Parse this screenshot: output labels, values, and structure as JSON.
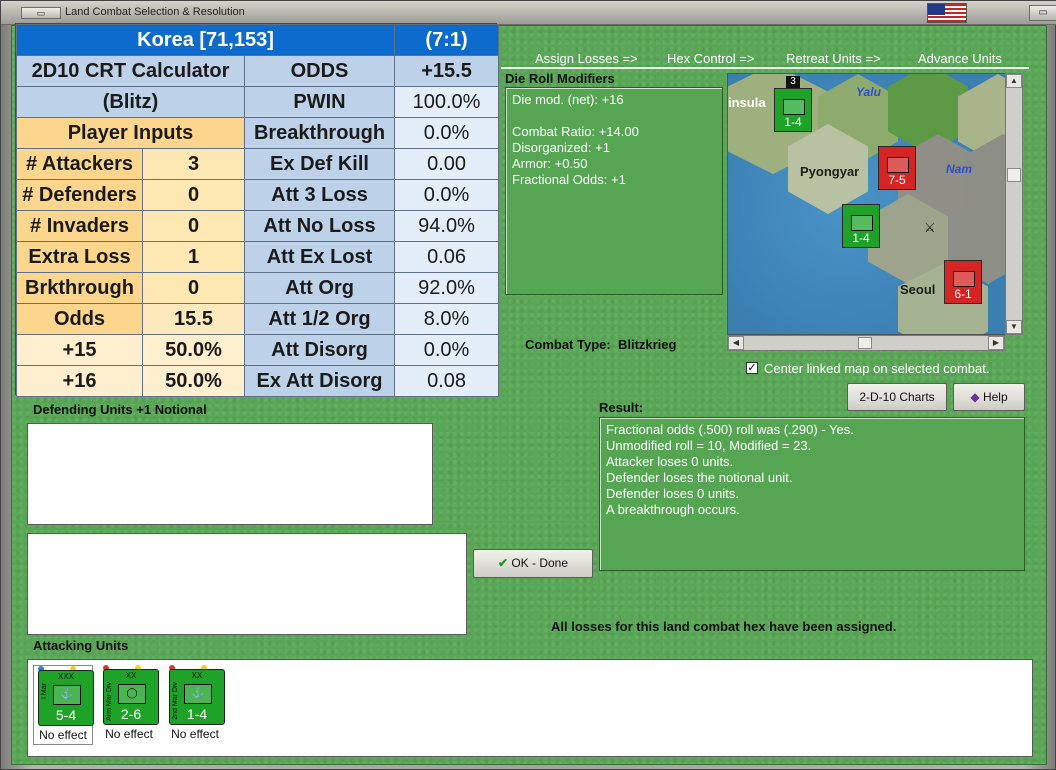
{
  "window": {
    "title": "Land Combat Selection & Resolution"
  },
  "steps": [
    "Assign Losses =>",
    "Hex Control =>",
    "Retreat Units =>",
    "Advance Units"
  ],
  "calculator": {
    "title": "Korea [71,153]",
    "odds_header": "(7:1)",
    "name_line1": "2D10 CRT Calculator",
    "name_line2": "(Blitz)",
    "player_inputs": "Player Inputs",
    "inputs": [
      {
        "label": "# Attackers",
        "value": "3"
      },
      {
        "label": "# Defenders",
        "value": "0"
      },
      {
        "label": "# Invaders",
        "value": "0"
      },
      {
        "label": "Extra Loss",
        "value": "1"
      },
      {
        "label": "Brkthrough",
        "value": "0"
      },
      {
        "label": "Odds",
        "value": "15.5"
      },
      {
        "label": "+15",
        "value": "50.0%"
      },
      {
        "label": "+16",
        "value": "50.0%"
      }
    ],
    "results": [
      {
        "label": "ODDS",
        "value": "+15.5"
      },
      {
        "label": "PWIN",
        "value": "100.0%"
      },
      {
        "label": "Breakthrough",
        "value": "0.0%"
      },
      {
        "label": "Ex Def Kill",
        "value": "0.00"
      },
      {
        "label": "Att 3 Loss",
        "value": "0.0%"
      },
      {
        "label": "Att No Loss",
        "value": "94.0%"
      },
      {
        "label": "Att Ex Lost",
        "value": "0.06"
      },
      {
        "label": "Att Org",
        "value": "92.0%"
      },
      {
        "label": "Att 1/2 Org",
        "value": "8.0%"
      },
      {
        "label": "Att Disorg",
        "value": "0.0%"
      },
      {
        "label": "Ex Att Disorg",
        "value": "0.08"
      }
    ]
  },
  "drm": {
    "heading": "Die Roll Modifiers",
    "lines": [
      "Die mod. (net): +16",
      "",
      "Combat Ratio: +14.00",
      "Disorganized: +1",
      "Armor: +0.50",
      "Fractional Odds: +1"
    ]
  },
  "map": {
    "cities": [
      "Pyongyar",
      "Seoul",
      "insula"
    ],
    "rivers": [
      "Yalu",
      "Nam"
    ],
    "counters": [
      {
        "value": "1-4",
        "size": "XX",
        "color": "green"
      },
      {
        "value": "7-5",
        "size": "XXX",
        "color": "red"
      },
      {
        "value": "1-4",
        "size": "XX",
        "color": "green"
      },
      {
        "value": "6-1",
        "size": "XXXX",
        "color": "red"
      }
    ],
    "counter_badge": "3"
  },
  "combat_type": {
    "label": "Combat Type:",
    "value": "Blitzkrieg"
  },
  "center_map": {
    "label": "Center linked map on selected combat.",
    "checked": true
  },
  "buttons": {
    "charts": "2-D-10 Charts",
    "help": "Help",
    "ok": "OK - Done"
  },
  "result": {
    "heading": "Result:",
    "lines": [
      "Fractional odds (.500) roll was (.290)  - Yes.",
      "Unmodified roll = 10, Modified = 23.",
      "Attacker loses 0 units.",
      "Defender loses the notional unit.",
      "Defender loses 0 units.",
      "A breakthrough occurs."
    ]
  },
  "defending_heading": "Defending Units +1 Notional",
  "attacking_heading": "Attacking Units",
  "losses_message": "All losses for this land combat hex have been assigned.",
  "attackers": [
    {
      "value": "5-4",
      "size": "XXX",
      "side": "I Mar",
      "effect": "No effect"
    },
    {
      "value": "2-6",
      "size": "XX",
      "side": "Arm Mar Div",
      "effect": "No effect"
    },
    {
      "value": "1-4",
      "size": "XX",
      "side": "2nd Mar Div",
      "effect": "No effect"
    }
  ]
}
